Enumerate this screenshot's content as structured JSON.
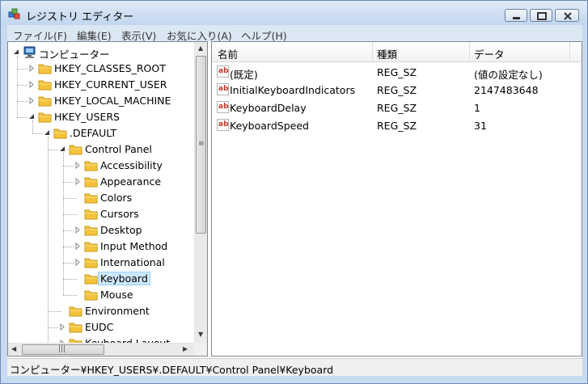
{
  "window": {
    "title": "レジストリ エディター"
  },
  "menu": [
    "ファイル(F)",
    "編集(E)",
    "表示(V)",
    "お気に入り(A)",
    "ヘルプ(H)"
  ],
  "tree": [
    {
      "label": "コンピューター",
      "level": 0,
      "toggle": "expanded",
      "icon": "computer"
    },
    {
      "label": "HKEY_CLASSES_ROOT",
      "level": 1,
      "toggle": "collapsed",
      "icon": "folder"
    },
    {
      "label": "HKEY_CURRENT_USER",
      "level": 1,
      "toggle": "collapsed",
      "icon": "folder"
    },
    {
      "label": "HKEY_LOCAL_MACHINE",
      "level": 1,
      "toggle": "collapsed",
      "icon": "folder"
    },
    {
      "label": "HKEY_USERS",
      "level": 1,
      "toggle": "expanded",
      "icon": "folder"
    },
    {
      "label": ".DEFAULT",
      "level": 2,
      "toggle": "expanded",
      "icon": "folder"
    },
    {
      "label": "Control Panel",
      "level": 3,
      "toggle": "expanded",
      "icon": "folder"
    },
    {
      "label": "Accessibility",
      "level": 4,
      "toggle": "collapsed",
      "icon": "folder"
    },
    {
      "label": "Appearance",
      "level": 4,
      "toggle": "collapsed",
      "icon": "folder"
    },
    {
      "label": "Colors",
      "level": 4,
      "toggle": "none",
      "icon": "folder"
    },
    {
      "label": "Cursors",
      "level": 4,
      "toggle": "none",
      "icon": "folder"
    },
    {
      "label": "Desktop",
      "level": 4,
      "toggle": "collapsed",
      "icon": "folder"
    },
    {
      "label": "Input Method",
      "level": 4,
      "toggle": "collapsed",
      "icon": "folder"
    },
    {
      "label": "International",
      "level": 4,
      "toggle": "collapsed",
      "icon": "folder"
    },
    {
      "label": "Keyboard",
      "level": 4,
      "toggle": "none",
      "icon": "folder",
      "selected": true
    },
    {
      "label": "Mouse",
      "level": 4,
      "toggle": "none",
      "icon": "folder"
    },
    {
      "label": "Environment",
      "level": 3,
      "toggle": "none",
      "icon": "folder"
    },
    {
      "label": "EUDC",
      "level": 3,
      "toggle": "collapsed",
      "icon": "folder"
    },
    {
      "label": "Keyboard Layout",
      "level": 3,
      "toggle": "collapsed",
      "icon": "folder"
    }
  ],
  "list": {
    "columns": [
      "名前",
      "種類",
      "データ"
    ],
    "rows": [
      {
        "name": "(既定)",
        "type": "REG_SZ",
        "data": "(値の設定なし)",
        "icon": "string-value-icon"
      },
      {
        "name": "InitialKeyboardIndicators",
        "type": "REG_SZ",
        "data": "2147483648",
        "icon": "string-value-icon"
      },
      {
        "name": "KeyboardDelay",
        "type": "REG_SZ",
        "data": "1",
        "icon": "string-value-icon"
      },
      {
        "name": "KeyboardSpeed",
        "type": "REG_SZ",
        "data": "31",
        "icon": "string-value-icon"
      }
    ]
  },
  "icon_glyph": "ab",
  "status": {
    "path": "コンピューター¥HKEY_USERS¥.DEFAULT¥Control Panel¥Keyboard"
  },
  "colors": {
    "selection": "#cde8ff",
    "selection_border": "#99d1ff",
    "folder": "#f5c33b",
    "value_icon": "#c0392b"
  }
}
